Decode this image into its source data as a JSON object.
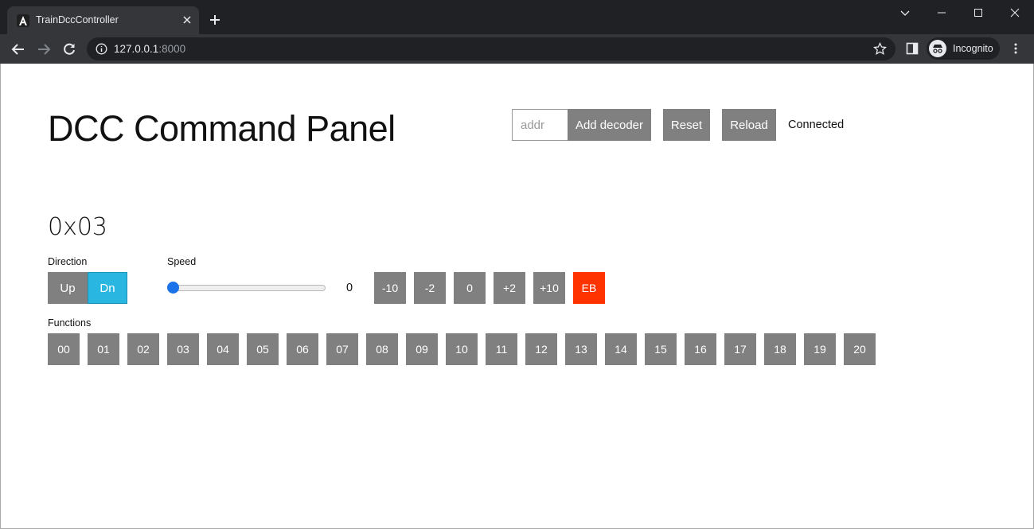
{
  "browser": {
    "tab_title": "TrainDccController",
    "url_host": "127.0.0.1",
    "url_port": ":8000",
    "profile_label": "Incognito"
  },
  "header": {
    "title": "DCC Command Panel",
    "addr_placeholder": "addr",
    "add_decoder_label": "Add decoder",
    "reset_label": "Reset",
    "reload_label": "Reload",
    "status_text": "Connected"
  },
  "decoder": {
    "address": "0x03",
    "direction_label": "Direction",
    "direction_up": "Up",
    "direction_dn": "Dn",
    "direction_selected": "Dn",
    "speed_label": "Speed",
    "speed_value": "0",
    "speed_buttons": [
      "-10",
      "-2",
      "0",
      "+2",
      "+10",
      "EB"
    ],
    "functions_label": "Functions",
    "functions": [
      "00",
      "01",
      "02",
      "03",
      "04",
      "05",
      "06",
      "07",
      "08",
      "09",
      "10",
      "11",
      "12",
      "13",
      "14",
      "15",
      "16",
      "17",
      "18",
      "19",
      "20"
    ]
  },
  "colors": {
    "button_gray": "#808080",
    "direction_active": "#29b6e0",
    "emergency_brake": "#ff3300",
    "slider_thumb": "#1a73e8"
  }
}
